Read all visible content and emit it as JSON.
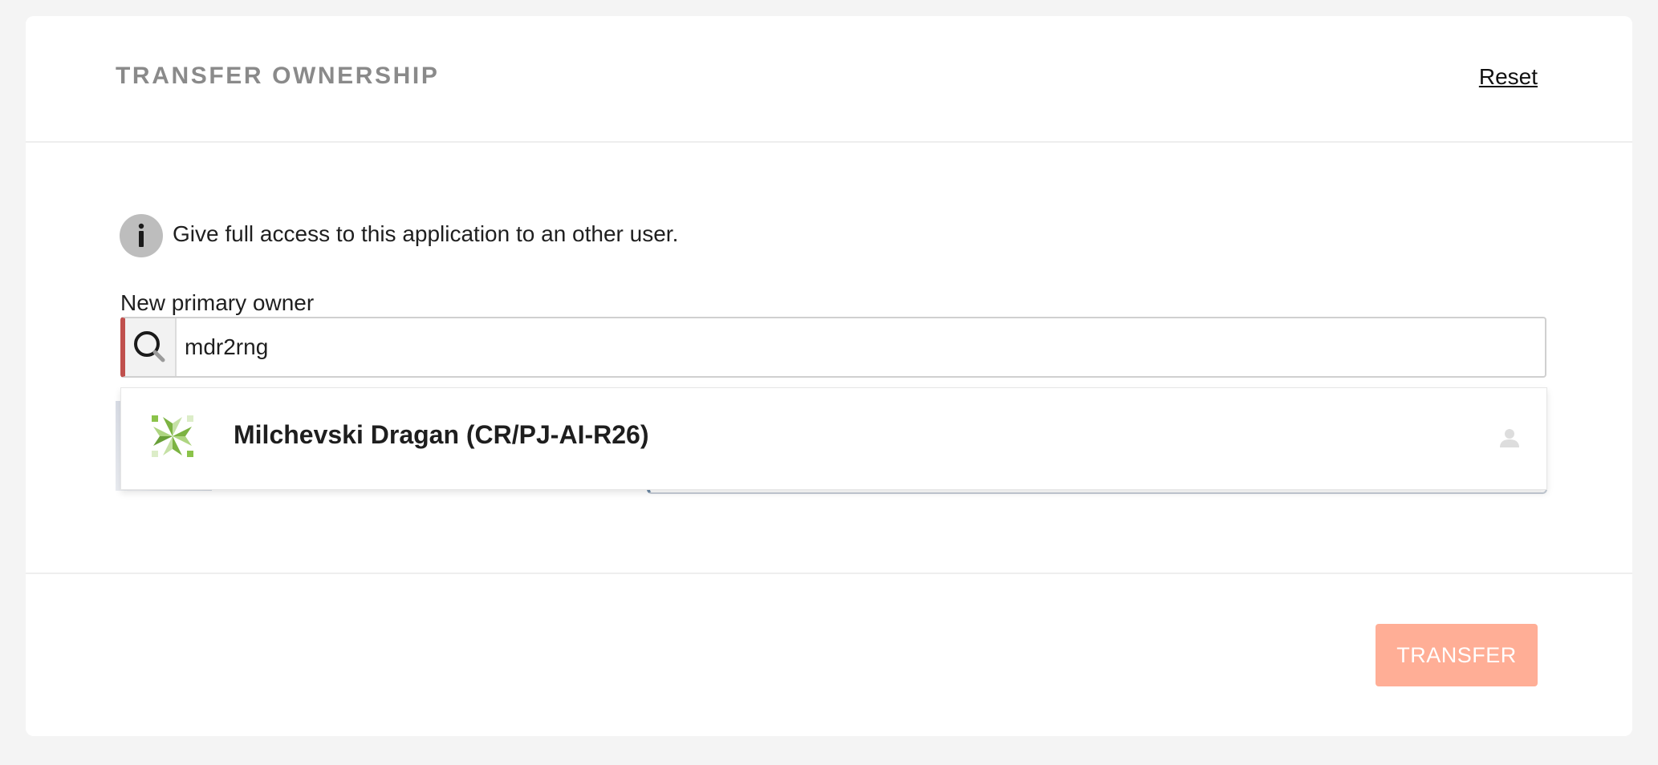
{
  "header": {
    "title": "TRANSFER OWNERSHIP",
    "reset_label": "Reset"
  },
  "info": {
    "icon": "info-icon",
    "text": "Give full access to this application to an other user."
  },
  "owner_field": {
    "label": "New primary owner",
    "value": "mdr2rng",
    "icon": "search-icon"
  },
  "dropdown": {
    "options": [
      {
        "name": "Milchevski Dragan (CR/PJ-AI-R26)",
        "avatar": "identicon-avatar",
        "type_icon": "user-icon"
      }
    ]
  },
  "footer": {
    "transfer_label": "TRANSFER"
  },
  "colors": {
    "accent_error": "#c0504d",
    "transfer_button": "#ffae96",
    "title_gray": "#8a8a8a",
    "avatar_green": "#7cb342"
  }
}
